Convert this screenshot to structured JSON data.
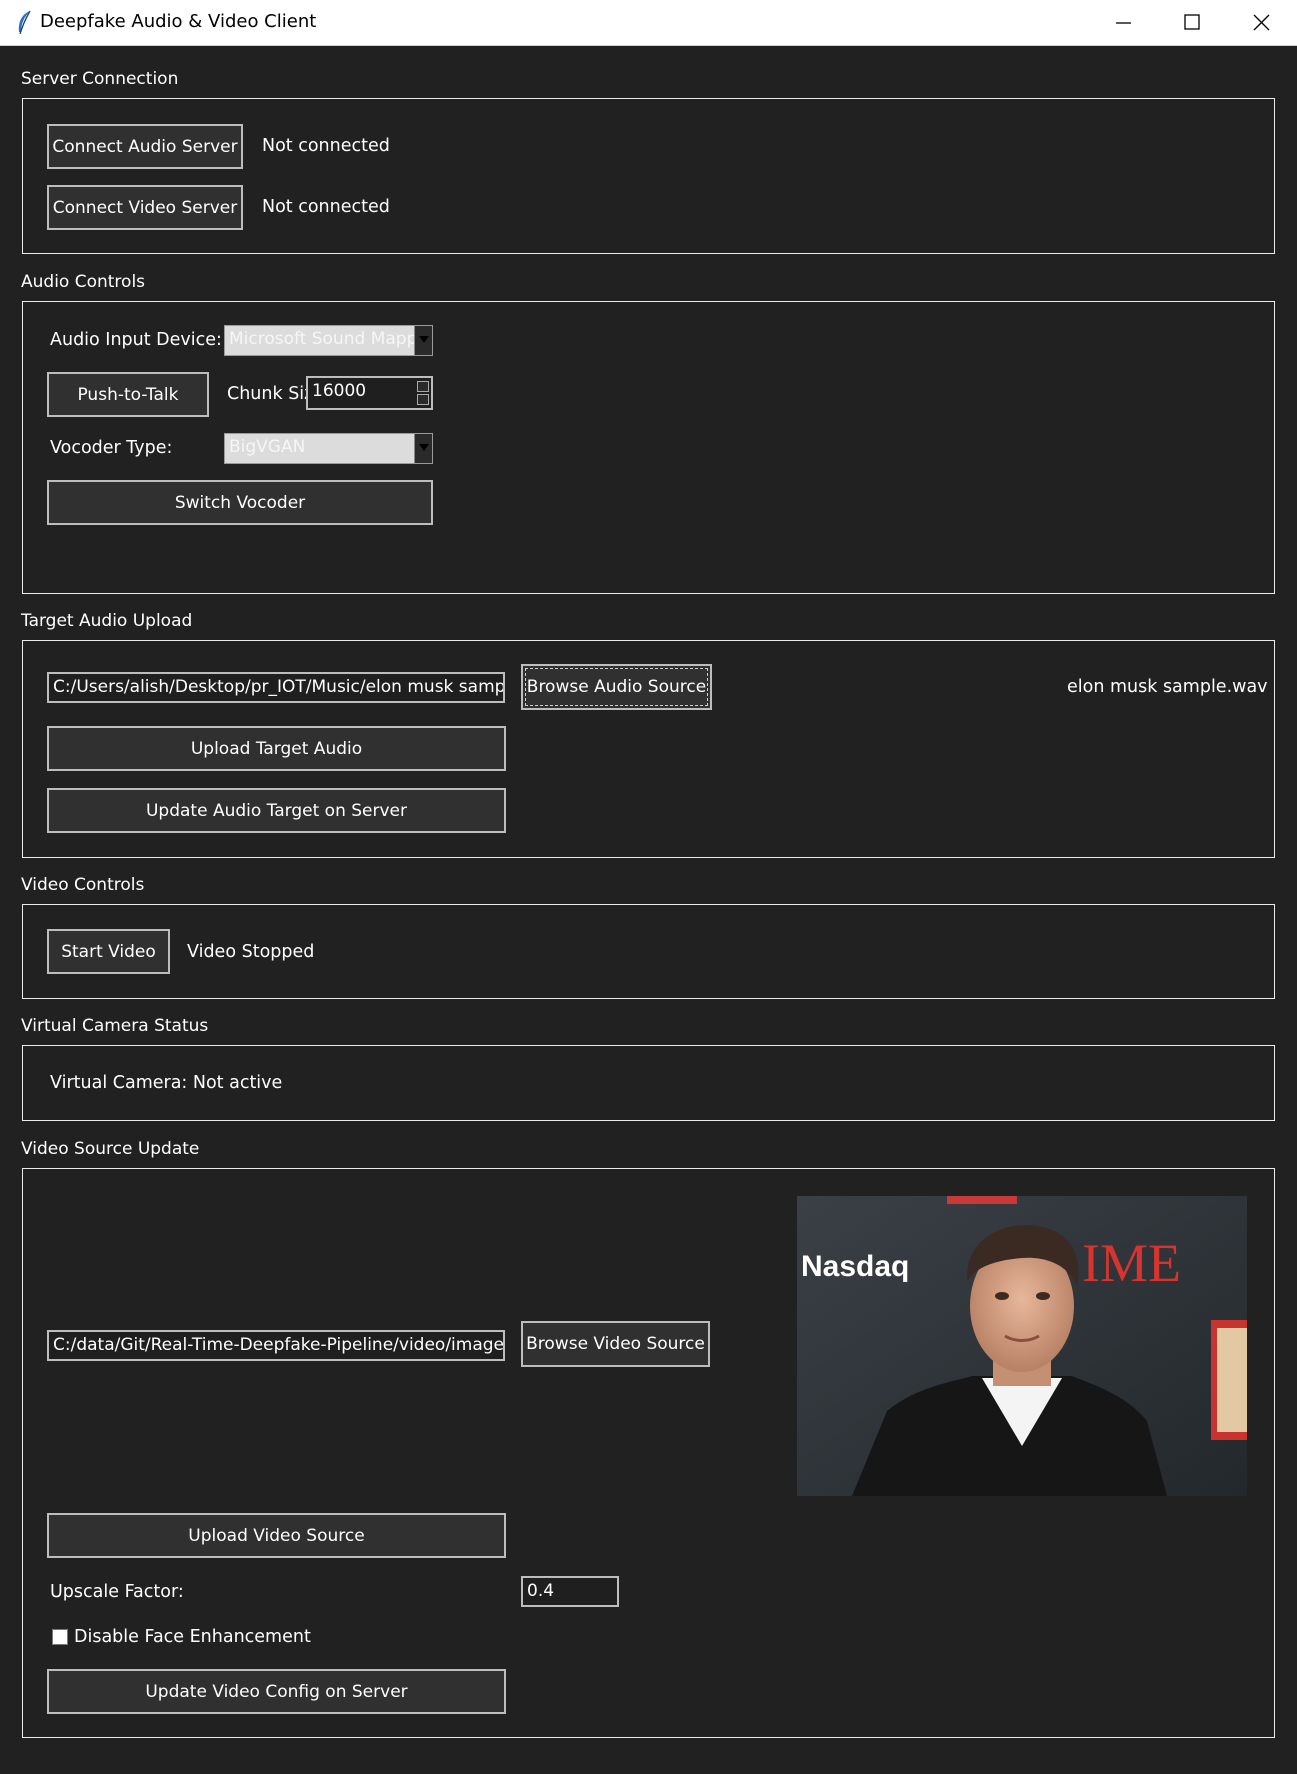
{
  "window": {
    "title": "Deepfake Audio & Video Client"
  },
  "server_connection": {
    "label": "Server Connection",
    "connect_audio_label": "Connect Audio Server",
    "audio_status": "Not connected",
    "connect_video_label": "Connect Video Server",
    "video_status": "Not connected"
  },
  "audio_controls": {
    "label": "Audio Controls",
    "input_device_label": "Audio Input Device:",
    "input_device_value": "Microsoft Sound Mapper",
    "push_to_talk_label": "Push-to-Talk",
    "chunk_size_label": "Chunk Siz",
    "chunk_size_value": "16000",
    "vocoder_label": "Vocoder Type:",
    "vocoder_value": "BigVGAN",
    "switch_vocoder_label": "Switch Vocoder"
  },
  "target_audio": {
    "label": "Target Audio Upload",
    "path_value": "C:/Users/alish/Desktop/pr_IOT/Music/elon musk sample.",
    "browse_label": "Browse Audio Source",
    "selected_file": "elon musk sample.wav",
    "upload_label": "Upload Target Audio",
    "update_label": "Update Audio Target on Server"
  },
  "video_controls": {
    "label": "Video Controls",
    "start_label": "Start Video",
    "status": "Video Stopped"
  },
  "virtual_camera": {
    "label": "Virtual Camera Status",
    "status": "Virtual Camera: Not active"
  },
  "video_source": {
    "label": "Video Source Update",
    "path_value": "C:/data/Git/Real-Time-Deepfake-Pipeline/video/image.jp",
    "browse_label": "Browse Video Source",
    "upload_label": "Upload Video Source",
    "upscale_label": "Upscale Factor:",
    "upscale_value": "0.4",
    "disable_enhancement_label": "Disable Face Enhancement",
    "disable_enhancement_checked": false,
    "update_config_label": "Update Video Config on Server",
    "preview": {
      "backdrop_text_1": "Nasdaq",
      "backdrop_text_2": "IME"
    }
  }
}
